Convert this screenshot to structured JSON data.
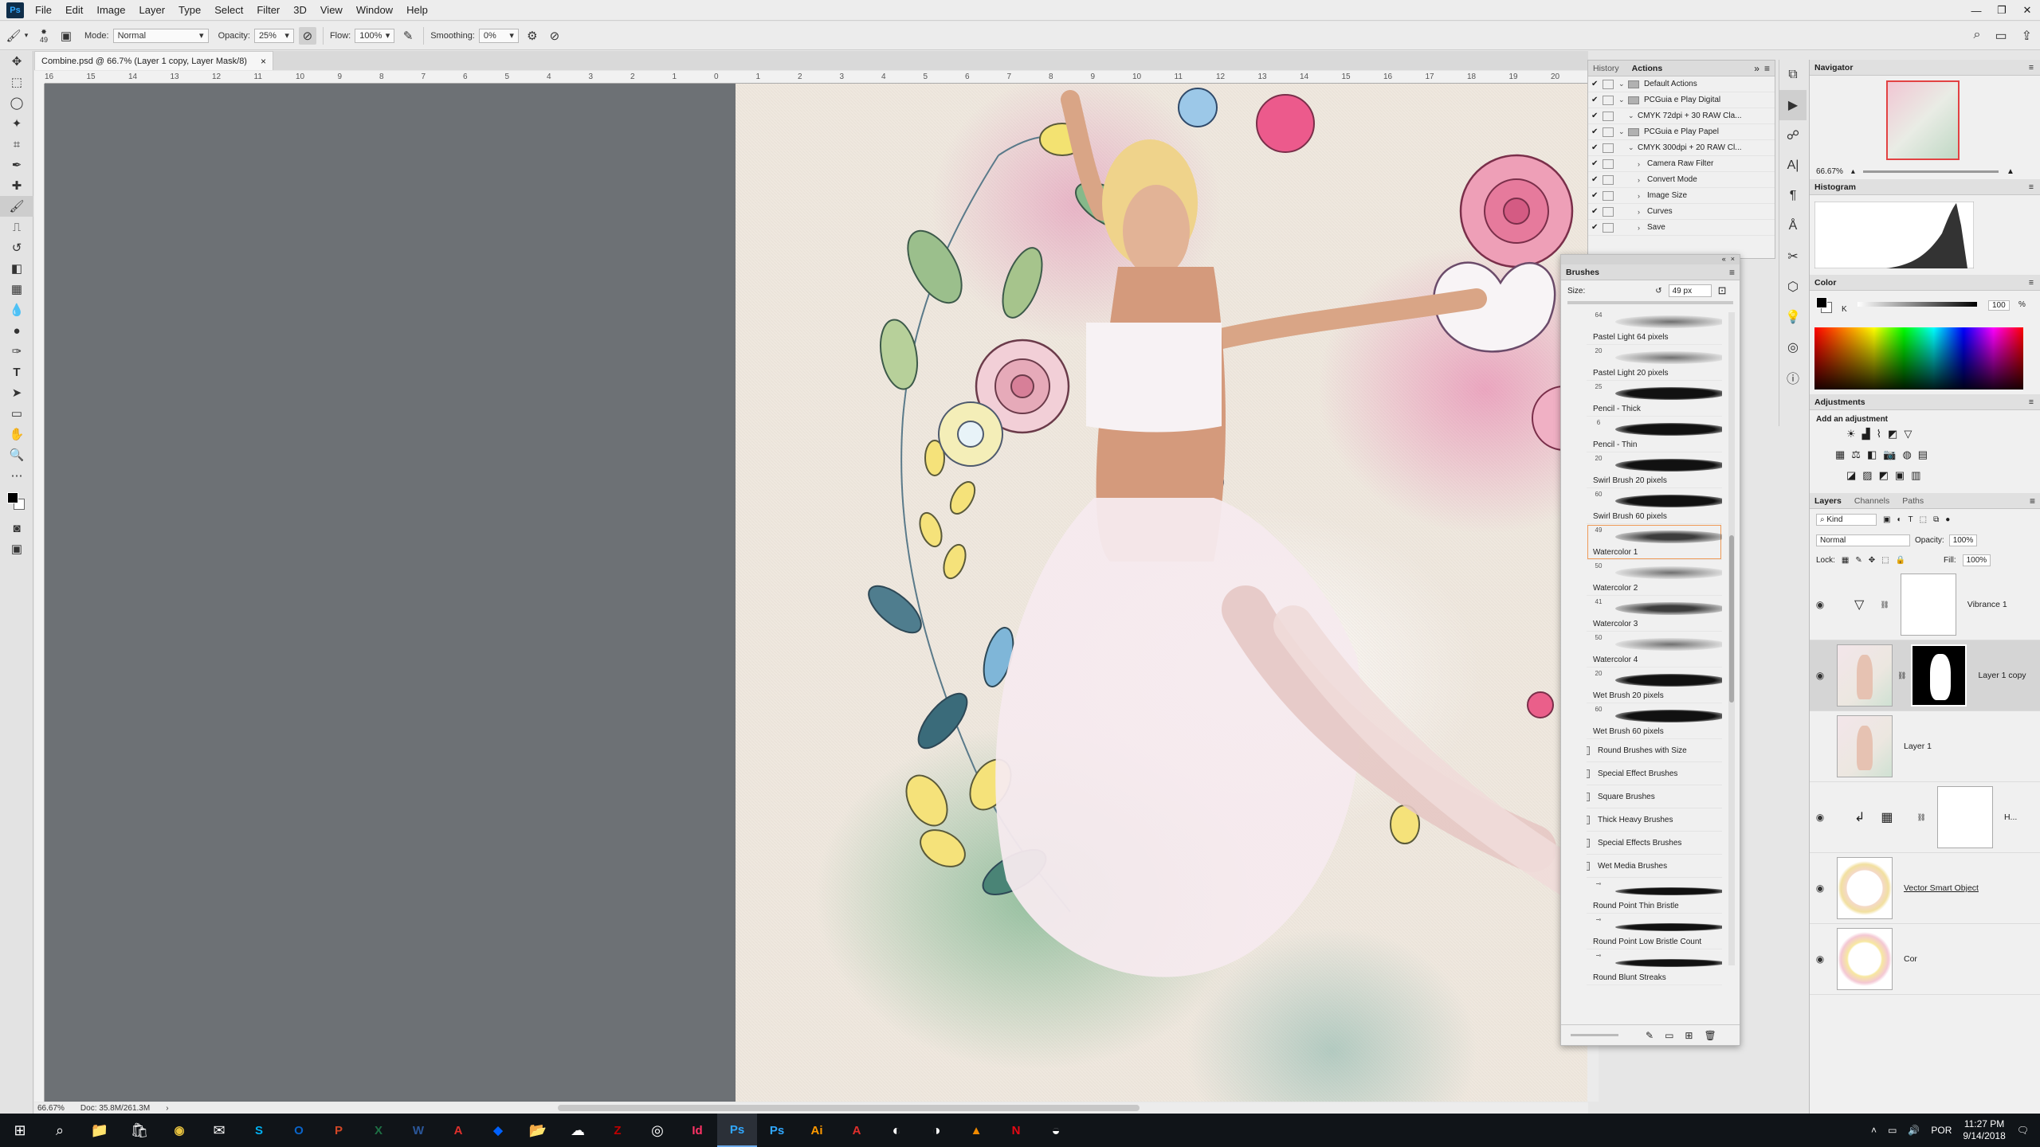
{
  "app": {
    "logo": "Ps",
    "window_controls": [
      "—",
      "❐",
      "✕"
    ]
  },
  "menu": [
    "File",
    "Edit",
    "Image",
    "Layer",
    "Type",
    "Select",
    "Filter",
    "3D",
    "View",
    "Window",
    "Help"
  ],
  "options": {
    "brush_size": "49",
    "mode_label": "Mode:",
    "mode_value": "Normal",
    "opacity_label": "Opacity:",
    "opacity_value": "25%",
    "flow_label": "Flow:",
    "flow_value": "100%",
    "smoothing_label": "Smoothing:",
    "smoothing_value": "0%"
  },
  "document": {
    "tab_title": "Combine.psd @ 66.7% (Layer 1 copy, Layer Mask/8)",
    "close": "×",
    "zoom": "66.67%",
    "doc_size": "Doc: 35.8M/261.3M",
    "ruler_ticks": [
      "16",
      "15",
      "14",
      "13",
      "12",
      "11",
      "10",
      "9",
      "8",
      "7",
      "6",
      "5",
      "4",
      "3",
      "2",
      "1",
      "0",
      "1",
      "2",
      "3",
      "4",
      "5",
      "6",
      "7",
      "8",
      "9",
      "10",
      "11",
      "12",
      "13",
      "14",
      "15",
      "16",
      "17",
      "18",
      "19",
      "20"
    ]
  },
  "history_panel": {
    "tabs": [
      "History",
      "Actions"
    ],
    "rows": [
      {
        "label": "Default Actions",
        "level": 0,
        "type": "set"
      },
      {
        "label": "PCGuia e Play Digital",
        "level": 0,
        "type": "set"
      },
      {
        "label": "CMYK 72dpi + 30 RAW Cla...",
        "level": 1,
        "type": "action"
      },
      {
        "label": "PCGuia e Play Papel",
        "level": 0,
        "type": "set"
      },
      {
        "label": "CMYK 300dpi + 20 RAW Cl...",
        "level": 1,
        "type": "action"
      },
      {
        "label": "Camera Raw Filter",
        "level": 2,
        "type": "step"
      },
      {
        "label": "Convert Mode",
        "level": 2,
        "type": "step"
      },
      {
        "label": "Image Size",
        "level": 2,
        "type": "step"
      },
      {
        "label": "Curves",
        "level": 2,
        "type": "step"
      },
      {
        "label": "Save",
        "level": 2,
        "type": "step"
      }
    ]
  },
  "brushes_panel": {
    "title": "Brushes",
    "size_label": "Size:",
    "size_value": "49 px",
    "brushes": [
      {
        "num": "64",
        "name": "Pastel Light 64 pixels",
        "style": "soft"
      },
      {
        "num": "20",
        "name": "Pastel Light 20 pixels",
        "style": "soft"
      },
      {
        "num": "25",
        "name": "Pencil - Thick",
        "style": "hard"
      },
      {
        "num": "6",
        "name": "Pencil - Thin",
        "style": "hard"
      },
      {
        "num": "20",
        "name": "Swirl Brush 20 pixels",
        "style": "hard"
      },
      {
        "num": "60",
        "name": "Swirl Brush 60 pixels",
        "style": "hard"
      },
      {
        "num": "49",
        "name": "Watercolor 1",
        "style": "medium",
        "selected": true
      },
      {
        "num": "50",
        "name": "Watercolor 2",
        "style": "soft"
      },
      {
        "num": "41",
        "name": "Watercolor 3",
        "style": "medium"
      },
      {
        "num": "50",
        "name": "Watercolor 4",
        "style": "soft"
      },
      {
        "num": "20",
        "name": "Wet Brush 20 pixels",
        "style": "hard"
      },
      {
        "num": "60",
        "name": "Wet Brush 60 pixels",
        "style": "hard"
      }
    ],
    "folders": [
      "Round Brushes with Size",
      "Special Effect Brushes",
      "Square Brushes",
      "Thick Heavy Brushes",
      "Special Effects Brushes",
      "Wet Media Brushes"
    ],
    "wet_media": [
      {
        "name": "Round Point Thin Bristle"
      },
      {
        "name": "Round Point Low Bristle Count"
      },
      {
        "name": "Round Blunt Streaks"
      }
    ]
  },
  "navigator": {
    "title": "Navigator",
    "zoom": "66.67%"
  },
  "histogram": {
    "title": "Histogram"
  },
  "color": {
    "title": "Color",
    "channel": "K",
    "value": "100",
    "unit": "%"
  },
  "adjustments": {
    "title": "Adjustments",
    "subtitle": "Add an adjustment"
  },
  "layers_panel": {
    "tabs": [
      "Layers",
      "Channels",
      "Paths"
    ],
    "filter": "Kind",
    "blend": "Normal",
    "opacity_label": "Opacity:",
    "opacity_value": "100%",
    "lock_label": "Lock:",
    "fill_label": "Fill:",
    "fill_value": "100%",
    "layers": [
      {
        "name": "Vibrance 1",
        "visible": true,
        "kind": "adjustment"
      },
      {
        "name": "Layer 1 copy",
        "visible": true,
        "kind": "masked",
        "selected": true
      },
      {
        "name": "Layer 1",
        "visible": false,
        "kind": "pixel"
      },
      {
        "name": "H...",
        "visible": true,
        "kind": "adjustment2"
      },
      {
        "name": "Vector Smart Object",
        "visible": true,
        "kind": "smart"
      },
      {
        "name": "Cor",
        "visible": true,
        "kind": "smart2"
      }
    ]
  },
  "taskbar": {
    "time": "11:27 PM",
    "date": "9/14/2018",
    "language": "POR",
    "apps": [
      "start",
      "search",
      "files",
      "store",
      "chrome",
      "mail",
      "skype",
      "outlook",
      "powerpoint",
      "excel",
      "word",
      "acrobat",
      "dropbox",
      "filezilla-folder",
      "onedrive",
      "filezilla",
      "obs",
      "indesign",
      "photoshop",
      "photoshop2",
      "illustrator",
      "acrobat-reader",
      "steam",
      "vpn",
      "vlc",
      "netflix",
      "wacom"
    ]
  },
  "colors": {
    "accent_selection": "#ee9a57",
    "taskbar": "#101418"
  }
}
